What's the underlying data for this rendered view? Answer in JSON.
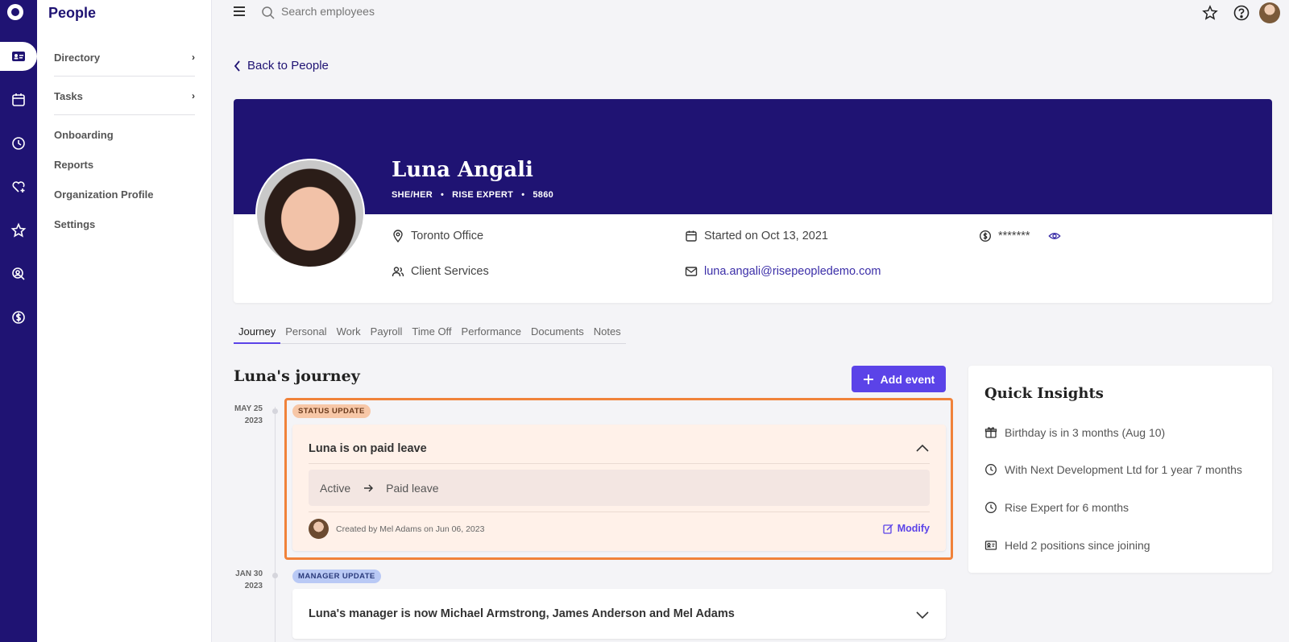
{
  "app": {
    "section_title": "People"
  },
  "subnav": {
    "items": [
      {
        "label": "Directory"
      },
      {
        "label": "Tasks"
      },
      {
        "label": "Onboarding"
      },
      {
        "label": "Reports"
      },
      {
        "label": "Organization Profile"
      },
      {
        "label": "Settings"
      }
    ]
  },
  "rail": {
    "icons": [
      "logo-icon",
      "people-card-icon",
      "calendar-icon",
      "clock-icon",
      "heart-plus-icon",
      "star-icon",
      "user-search-icon",
      "dollar-icon"
    ],
    "active": "people-card-icon"
  },
  "topbar": {
    "search_placeholder": "Search employees",
    "icons": [
      "menu-icon",
      "search-icon",
      "star-badge-icon",
      "help-icon",
      "avatar"
    ]
  },
  "back_link": "Back to People",
  "profile": {
    "name": "Luna Angali",
    "pronouns": "SHE/HER",
    "title": "RISE EXPERT",
    "employee_id": "5860",
    "separator": "•",
    "location": "Toronto Office",
    "department": "Client Services",
    "start_date": "Started on Oct 13, 2021",
    "email": "luna.angali@risepeopledemo.com",
    "salary_masked": "*******"
  },
  "tabs": [
    {
      "label": "Journey",
      "active": true
    },
    {
      "label": "Personal"
    },
    {
      "label": "Work"
    },
    {
      "label": "Payroll"
    },
    {
      "label": "Time Off"
    },
    {
      "label": "Performance"
    },
    {
      "label": "Documents"
    },
    {
      "label": "Notes"
    }
  ],
  "journey": {
    "title": "Luna's journey",
    "add_button": "Add event",
    "events": [
      {
        "date_month_day": "MAY 25",
        "date_year": "2023",
        "badge": "STATUS UPDATE",
        "title": "Luna is on paid leave",
        "from": "Active",
        "to": "Paid leave",
        "created": "Created by Mel Adams on Jun 06, 2023",
        "modify": "Modify",
        "expanded": true
      },
      {
        "date_month_day": "JAN 30",
        "date_year": "2023",
        "badge": "MANAGER UPDATE",
        "title": "Luna's manager is now Michael Armstrong, James Anderson and Mel Adams",
        "expanded": false
      }
    ]
  },
  "insights": {
    "title": "Quick Insights",
    "items": [
      {
        "text": "Birthday is in 3 months (Aug 10)",
        "icon": "gift-icon"
      },
      {
        "text": "With Next Development Ltd for 1 year 7 months",
        "icon": "clock-icon"
      },
      {
        "text": "Rise Expert for 6 months",
        "icon": "clock-icon"
      },
      {
        "text": "Held 2 positions since joining",
        "icon": "id-card-icon"
      }
    ]
  },
  "colors": {
    "brand_navy": "#1f1373",
    "accent_purple": "#5b43e8",
    "highlight_orange": "#f0823a",
    "status_badge": "#f7c7a7",
    "manager_badge": "#b9c9f5"
  }
}
